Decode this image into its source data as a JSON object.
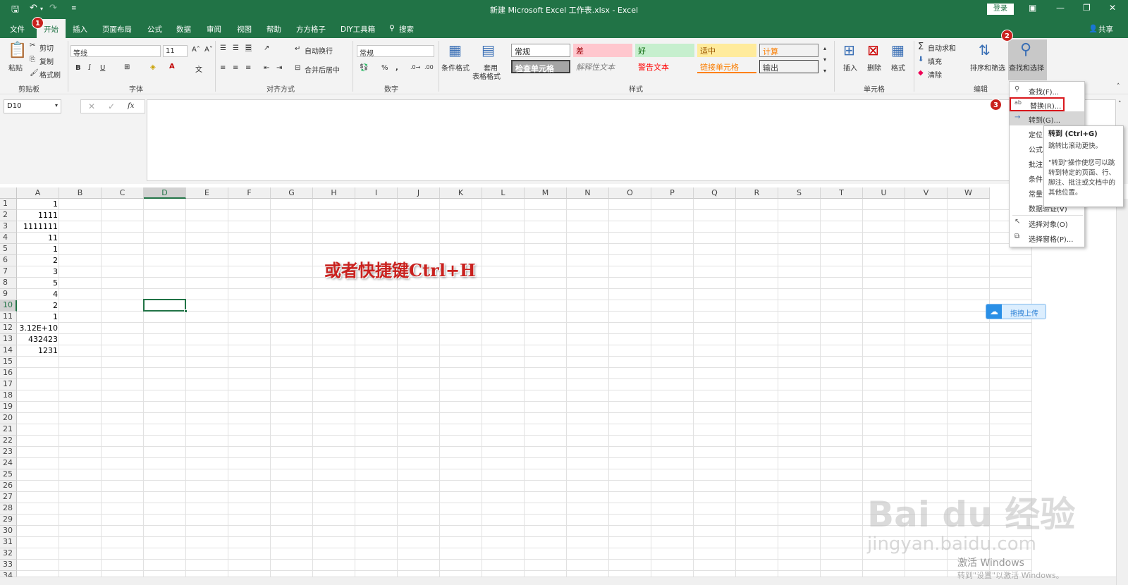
{
  "titlebar": {
    "title": "新建 Microsoft Excel 工作表.xlsx - Excel",
    "login": "登录",
    "save_icon": "save-icon",
    "undo_icon": "undo-icon",
    "redo_icon": "redo-icon",
    "bg": "#217346"
  },
  "tabs": [
    "文件",
    "开始",
    "插入",
    "页面布局",
    "公式",
    "数据",
    "审阅",
    "视图",
    "帮助",
    "方方格子",
    "DIY工具箱"
  ],
  "search_label": "搜索",
  "share_label": "共享",
  "ribbon": {
    "paste": "粘贴",
    "cut": "剪切",
    "copy": "复制",
    "format_painter": "格式刷",
    "clipboard": "剪贴板",
    "font_name": "等线",
    "font_size": "11",
    "font_group": "字体",
    "wrap_text": "自动换行",
    "merge_center": "合并后居中",
    "alignment_group": "对齐方式",
    "number_format": "常规",
    "number_group": "数字",
    "percent": "%",
    "comma": ",",
    "cond_format": "条件格式",
    "table_format_1": "套用",
    "table_format_2": "表格格式",
    "styles_group": "样式",
    "styles": [
      "常规",
      "差",
      "好",
      "适中",
      "计算",
      "检查单元格",
      "解释性文本",
      "警告文本",
      "链接单元格",
      "输出"
    ],
    "insert": "插入",
    "delete": "删除",
    "format": "格式",
    "cells_group": "单元格",
    "autosum": "自动求和",
    "fill": "填充",
    "clear": "清除",
    "sort_filter": "排序和筛选",
    "find_select": "查找和选择",
    "editing_group": "编辑"
  },
  "namebox": "D10",
  "fx": "fx",
  "columns": [
    "A",
    "B",
    "C",
    "D",
    "E",
    "F",
    "G",
    "H",
    "I",
    "J",
    "K",
    "L",
    "M",
    "N",
    "O",
    "P",
    "Q",
    "R",
    "S",
    "T",
    "U",
    "V",
    "W"
  ],
  "rows": [
    "1",
    "2",
    "3",
    "4",
    "5",
    "6",
    "7",
    "8",
    "9",
    "10",
    "11",
    "12",
    "13",
    "14",
    "15",
    "16",
    "17",
    "18",
    "19",
    "20",
    "21",
    "22",
    "23",
    "24",
    "25",
    "26",
    "27",
    "28",
    "29",
    "30",
    "31",
    "32",
    "33",
    "34"
  ],
  "colA": [
    "1",
    "1111",
    "1111111",
    "11",
    "1",
    "2",
    "3",
    "5",
    "4",
    "2",
    "1",
    "3.12E+10",
    "432423",
    "1231"
  ],
  "menu": {
    "find": "查找(F)...",
    "replace": "替换(R)...",
    "goto": "转到(G)...",
    "goto_special": "定位",
    "formulas": "公式",
    "comments": "批注",
    "cond": "条件",
    "constants": "常量",
    "data_validation": "数据验证(V)",
    "select_objects": "选择对象(O)",
    "selection_pane": "选择窗格(P)..."
  },
  "tooltip": {
    "title": "转到 (Ctrl+G)",
    "line1": "跳转比滚动更快。",
    "line2": "\"转到\"操作使您可以跳转到特定的页面、行、脚注、批注或文档中的其他位置。"
  },
  "badges": [
    "1",
    "2",
    "3"
  ],
  "overlay_text": "或者快捷键Ctrl+H",
  "upload_label": "拖拽上传",
  "watermark": "Bai du 经验",
  "watermark_url": "jingyan.baidu.com",
  "activate_title": "激活 Windows",
  "activate_sub": "转到\"设置\"以激活 Windows。"
}
